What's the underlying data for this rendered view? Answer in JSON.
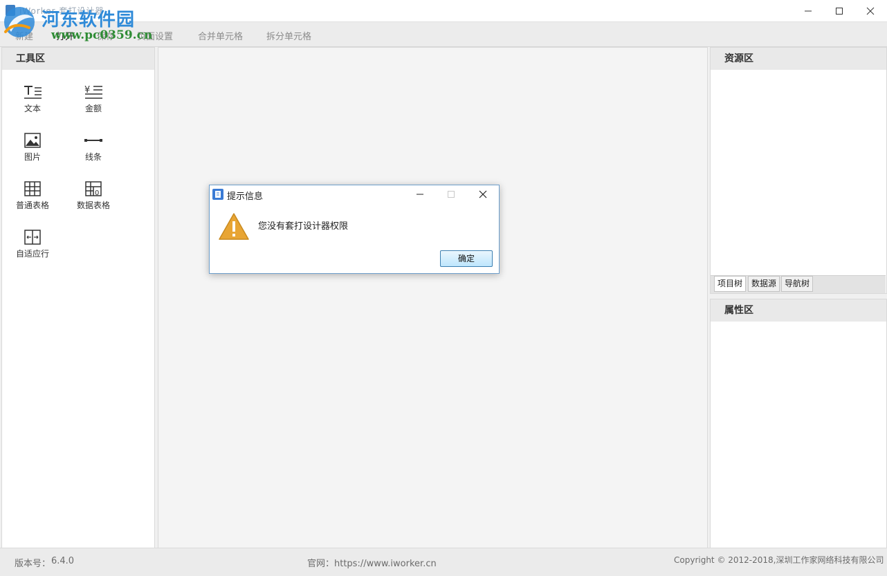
{
  "window": {
    "title": "iWorker 套打设计器",
    "min_glyph": "—",
    "max_glyph": "☐",
    "close_glyph": "✕"
  },
  "watermark": {
    "title": "河东软件园",
    "url": "www.pc0359.cn"
  },
  "menu": {
    "items": [
      "新建",
      "打开",
      "保存",
      "页面设置",
      "合并单元格",
      "拆分单元格"
    ]
  },
  "tool_panel": {
    "title": "工具区",
    "tools": [
      {
        "label": "文本",
        "icon": "text-icon"
      },
      {
        "label": "金额",
        "icon": "amount-icon"
      },
      {
        "label": "图片",
        "icon": "image-icon"
      },
      {
        "label": "线条",
        "icon": "line-icon"
      },
      {
        "label": "普通表格",
        "icon": "table-icon"
      },
      {
        "label": "数据表格",
        "icon": "data-table-icon"
      },
      {
        "label": "自适应行",
        "icon": "auto-row-icon"
      }
    ]
  },
  "resource_panel": {
    "title": "资源区",
    "tabs": [
      "项目树",
      "数据源",
      "导航树"
    ]
  },
  "property_panel": {
    "title": "属性区"
  },
  "status": {
    "version_label": "版本号：",
    "version": "6.4.0",
    "website": "官网：https://www.iworker.cn",
    "copyright": "Copyright © 2012-2018,深圳工作家网络科技有限公司"
  },
  "dialog": {
    "title": "提示信息",
    "message": "您没有套打设计器权限",
    "ok_label": "确定"
  },
  "colors": {
    "accent": "#3d7fc4",
    "warning": "#e8a534",
    "dialog_border": "#6c9ecb"
  }
}
